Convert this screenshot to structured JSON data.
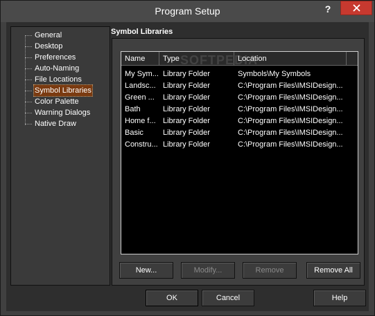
{
  "window": {
    "title": "Program Setup",
    "help_glyph": "?",
    "close_icon": "close-icon"
  },
  "tree": {
    "items": [
      {
        "label": "General",
        "selected": false
      },
      {
        "label": "Desktop",
        "selected": false
      },
      {
        "label": "Preferences",
        "selected": false
      },
      {
        "label": "Auto-Naming",
        "selected": false
      },
      {
        "label": "File Locations",
        "selected": false
      },
      {
        "label": "Symbol Libraries",
        "selected": true
      },
      {
        "label": "Color Palette",
        "selected": false
      },
      {
        "label": "Warning Dialogs",
        "selected": false
      },
      {
        "label": "Native Draw",
        "selected": false
      }
    ]
  },
  "panel": {
    "title": "Symbol Libraries",
    "columns": [
      "Name",
      "Type",
      "Location"
    ],
    "rows": [
      [
        "My Sym...",
        "Library Folder",
        "Symbols\\My Symbols"
      ],
      [
        "Landsc...",
        "Library Folder",
        "C:\\Program Files\\IMSIDesign..."
      ],
      [
        "Green ...",
        "Library Folder",
        "C:\\Program Files\\IMSIDesign..."
      ],
      [
        "Bath",
        "Library Folder",
        "C:\\Program Files\\IMSIDesign..."
      ],
      [
        "Home f...",
        "Library Folder",
        "C:\\Program Files\\IMSIDesign..."
      ],
      [
        "Basic",
        "Library Folder",
        "C:\\Program Files\\IMSIDesign..."
      ],
      [
        "Constru...",
        "Library Folder",
        "C:\\Program Files\\IMSIDesign..."
      ]
    ],
    "watermark": "SOFTPEDIA",
    "buttons": {
      "new": "New...",
      "modify": "Modify...",
      "remove": "Remove",
      "remove_all": "Remove All"
    }
  },
  "footer": {
    "ok": "OK",
    "cancel": "Cancel",
    "help": "Help"
  },
  "colors": {
    "selection": "#7a3a10",
    "close": "#c7392f",
    "list_bg": "#000000"
  }
}
